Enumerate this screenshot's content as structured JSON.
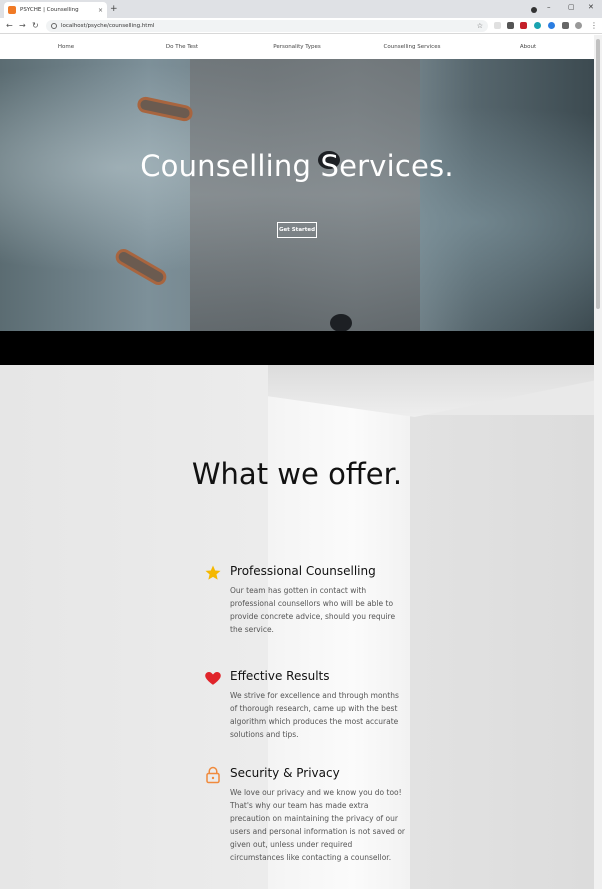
{
  "browser": {
    "tab_title": "PSYCHE | Counselling",
    "tab_close": "×",
    "new_tab": "+",
    "url": "localhost/psyche/counselling.html",
    "back": "←",
    "forward": "→",
    "reload": "↻",
    "star": "☆",
    "menu": "⋮",
    "minimize": "–",
    "maximize": "▢",
    "close": "✕"
  },
  "nav": {
    "items": [
      "Home",
      "Do The Test",
      "Personality Types",
      "Counselling Services",
      "About"
    ]
  },
  "hero": {
    "title": "Counselling Services.",
    "cta": "Get Started"
  },
  "offer": {
    "title": "What we offer.",
    "items": [
      {
        "icon": "star-icon",
        "heading": "Professional Counselling",
        "text": "Our team has gotten in contact with professional counsellors who will be able to provide concrete advice, should you require the service."
      },
      {
        "icon": "heart-icon",
        "heading": "Effective Results",
        "text": "We strive for excellence and through months of thorough research, came up with the best algorithm which produces the most accurate solutions and tips."
      },
      {
        "icon": "lock-icon",
        "heading": "Security & Privacy",
        "text": "We love our privacy and we know you do too! That's why our team has made extra precaution on maintaining the privacy of our users and personal information is not saved or given out, unless under required circumstances like contacting a counsellor."
      }
    ]
  },
  "colors": {
    "star": "#f5b800",
    "heart": "#e0242a",
    "lock": "#f08a3c",
    "favicon": "#f07a26"
  }
}
